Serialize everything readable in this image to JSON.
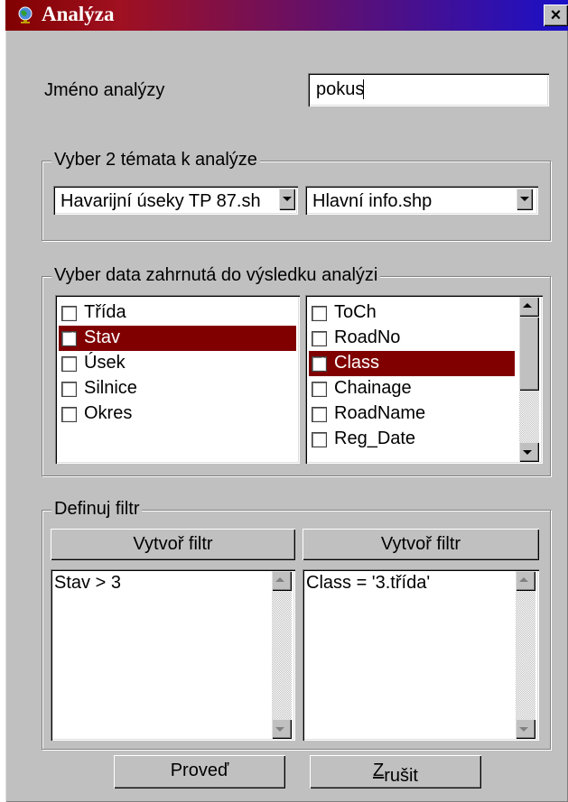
{
  "window": {
    "title": "Analýza",
    "close_label": "×"
  },
  "name": {
    "label": "Jméno analýzy",
    "value": "pokus"
  },
  "themes": {
    "group_title": "Vyber 2 témata k analýze",
    "left_combo": "Havarijní úseky TP 87.sh",
    "right_combo": "Hlavní info.shp"
  },
  "fields": {
    "group_title": "Vyber data zahrnutá do výsledku analýzi",
    "left": [
      {
        "label": "Třída",
        "checked": false,
        "selected": false
      },
      {
        "label": "Stav",
        "checked": true,
        "selected": true
      },
      {
        "label": "Úsek",
        "checked": false,
        "selected": false
      },
      {
        "label": "Silnice",
        "checked": false,
        "selected": false
      },
      {
        "label": "Okres",
        "checked": false,
        "selected": false
      }
    ],
    "right": [
      {
        "label": "ToCh",
        "checked": false,
        "selected": false
      },
      {
        "label": "RoadNo",
        "checked": false,
        "selected": false
      },
      {
        "label": "Class",
        "checked": true,
        "selected": true
      },
      {
        "label": "Chainage",
        "checked": false,
        "selected": false
      },
      {
        "label": "RoadName",
        "checked": false,
        "selected": false
      },
      {
        "label": "Reg_Date",
        "checked": false,
        "selected": false
      }
    ]
  },
  "filter": {
    "group_title": "Definuj filtr",
    "left_button": "Vytvoř filtr",
    "right_button": "Vytvoř filtr",
    "left_text": "Stav > 3",
    "right_text": "Class = '3.třída'"
  },
  "actions": {
    "run": "Proveď",
    "cancel": "Zrušit"
  },
  "colors": {
    "selection": "#800000",
    "face": "#c0c0c0",
    "title_start": "#800000",
    "title_end": "#1a10c8"
  }
}
